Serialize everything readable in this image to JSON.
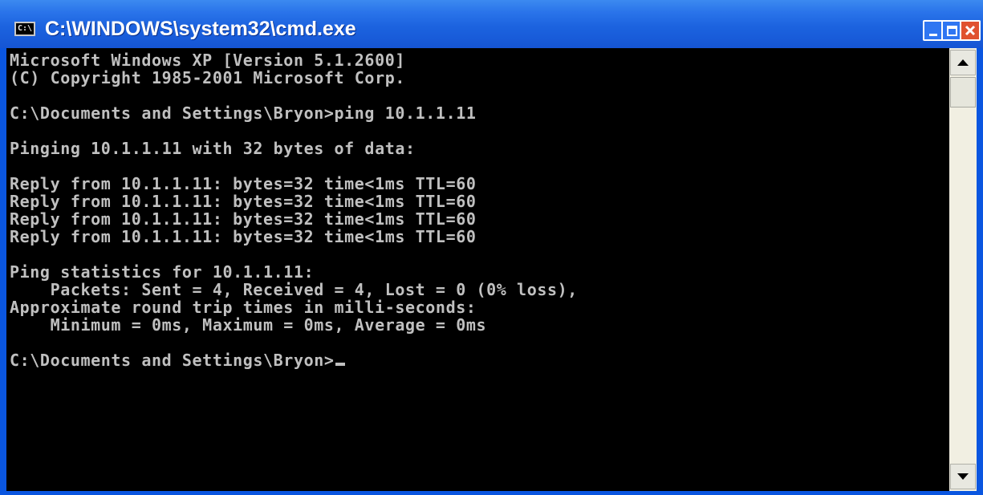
{
  "window": {
    "title": "C:\\WINDOWS\\system32\\cmd.exe",
    "icon_label": "C:\\",
    "icon": "cmd-icon"
  },
  "titlebar_buttons": {
    "minimize": "minimize-icon",
    "maximize": "maximize-icon",
    "close_glyph": "×"
  },
  "console": {
    "lines": [
      "Microsoft Windows XP [Version 5.1.2600]",
      "(C) Copyright 1985-2001 Microsoft Corp.",
      "",
      "C:\\Documents and Settings\\Bryon>ping 10.1.1.11",
      "",
      "Pinging 10.1.1.11 with 32 bytes of data:",
      "",
      "Reply from 10.1.1.11: bytes=32 time<1ms TTL=60",
      "Reply from 10.1.1.11: bytes=32 time<1ms TTL=60",
      "Reply from 10.1.1.11: bytes=32 time<1ms TTL=60",
      "Reply from 10.1.1.11: bytes=32 time<1ms TTL=60",
      "",
      "Ping statistics for 10.1.1.11:",
      "    Packets: Sent = 4, Received = 4, Lost = 0 (0% loss),",
      "Approximate round trip times in milli-seconds:",
      "    Minimum = 0ms, Maximum = 0ms, Average = 0ms",
      ""
    ],
    "prompt": "C:\\Documents and Settings\\Bryon>"
  },
  "colors": {
    "titlebar": "#1c63df",
    "console_bg": "#000000",
    "console_fg": "#c0c0c0",
    "close_button": "#e0522f"
  }
}
